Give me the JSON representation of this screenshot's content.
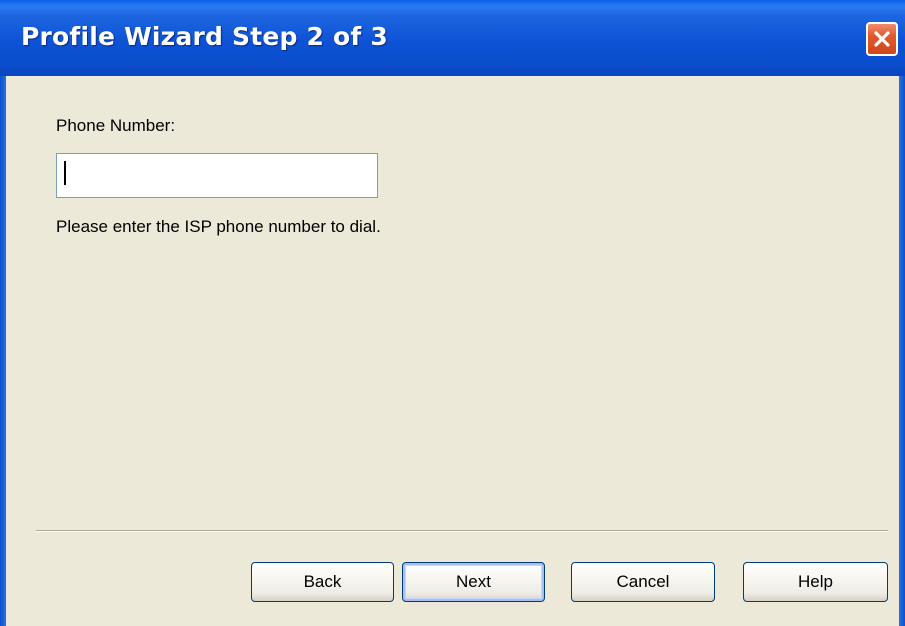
{
  "window": {
    "title": "Profile Wizard Step 2 of 3",
    "close_icon": "close-icon"
  },
  "form": {
    "phone_label": "Phone Number:",
    "phone_value": "",
    "hint": "Please enter the ISP phone number to dial."
  },
  "buttons": {
    "back": "Back",
    "next": "Next",
    "cancel": "Cancel",
    "help": "Help"
  },
  "colors": {
    "titlebar": "#0B4FCF",
    "dialog_bg": "#ECE9D8",
    "close_button": "#D2461C"
  }
}
